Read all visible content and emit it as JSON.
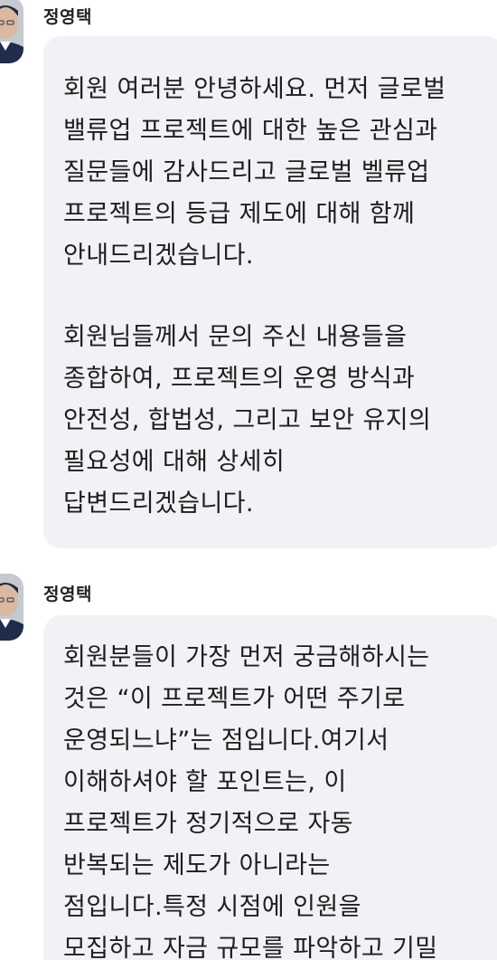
{
  "messages": [
    {
      "sender": "정영택",
      "paragraphs": [
        [
          "회원 여러분 안녕하세요. 먼저 글로벌",
          "밸류업 프로젝트에 대한 높은 관심과",
          "질문들에 감사드리고 글로벌 벨류업",
          "프로젝트의 등급 제도에 대해 함께",
          "안내드리겠습니다."
        ],
        [
          "회원님들께서 문의 주신 내용들을",
          "종합하여, 프로젝트의 운영 방식과",
          "안전성, 합법성, 그리고 보안 유지의",
          "필요성에 대해 상세히",
          "답변드리겠습니다."
        ]
      ]
    },
    {
      "sender": "정영택",
      "paragraphs": [
        [
          "회원분들이 가장 먼저 궁금해하시는",
          "것은 “이 프로젝트가 어떤 주기로",
          "운영되느냐”는 점입니다.여기서",
          "이해하셔야 할 포인트는, 이",
          "프로젝트가 정기적으로 자동",
          "반복되는 제도가 아니라는",
          "점입니다.특정 시점에 인원을",
          "모집하고 자금 규모를 파악하고 기밀"
        ]
      ]
    }
  ]
}
